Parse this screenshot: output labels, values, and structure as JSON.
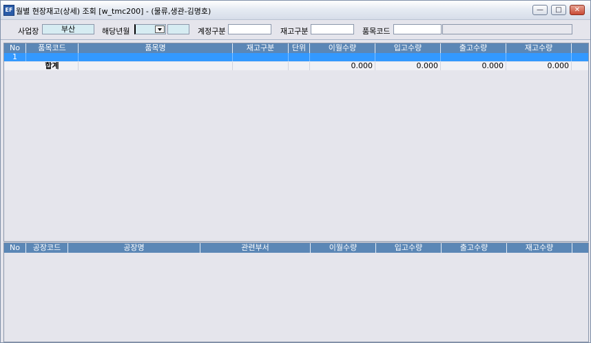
{
  "window": {
    "title": "월별 현장재고(상세) 조회 [w_tmc200] - (물류,생관-김명호)",
    "buttons": {
      "minimize": "—",
      "restore": "□",
      "close": "✕"
    }
  },
  "filters": {
    "site_label": "사업장",
    "site_value": "부산",
    "month_label": "해당년월",
    "month_value": "",
    "account_label": "계정구분",
    "account_value": "",
    "stock_type_label": "재고구분",
    "stock_type_value": "",
    "item_code_label": "품목코드",
    "item_code_value": ""
  },
  "grid_top": {
    "columns": [
      "No",
      "품목코드",
      "품목명",
      "재고구분",
      "단위",
      "이월수량",
      "입고수량",
      "출고수량",
      "재고수량"
    ],
    "rows": [
      {
        "no": "1",
        "item_code": "",
        "item_name": "",
        "stock_type": "",
        "unit": "",
        "carry": "",
        "in": "",
        "out": "",
        "stock": ""
      }
    ],
    "total": {
      "label": "합계",
      "carry": "0.000",
      "in": "0.000",
      "out": "0.000",
      "stock": "0.000"
    }
  },
  "grid_bottom": {
    "columns": [
      "No",
      "공장코드",
      "공장명",
      "관련부서",
      "이월수량",
      "입고수량",
      "출고수량",
      "재고수량"
    ]
  },
  "colors": {
    "header_bg": "#5b87b6",
    "selected_row": "#3399ff",
    "cyan_field": "#d6ecf2"
  }
}
